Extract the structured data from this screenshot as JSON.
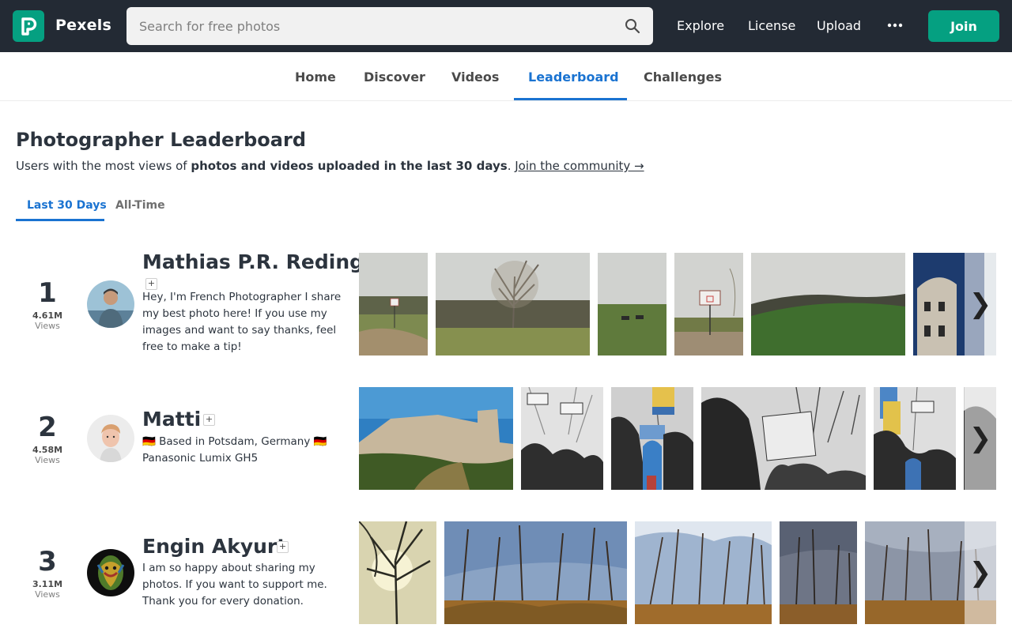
{
  "brand": {
    "name": "Pexels",
    "accent": "#05a081",
    "topbar_bg": "#232a34",
    "link_blue": "#1a73d1"
  },
  "search": {
    "placeholder": "Search for free photos",
    "value": ""
  },
  "top_nav": [
    "Explore",
    "License",
    "Upload"
  ],
  "join_label": "Join",
  "sub_nav": {
    "tabs": [
      "Home",
      "Discover",
      "Videos",
      "Leaderboard",
      "Challenges"
    ],
    "active": "Leaderboard"
  },
  "header": {
    "title": "Photographer Leaderboard",
    "subtitle_plain": "Users with the most views of ",
    "subtitle_bold": "photos and videos uploaded in the last 30 days",
    "subtitle_dot": ".",
    "join_link": "Join the community →"
  },
  "period_tabs": {
    "items": [
      "Last 30 Days",
      "All-Time"
    ],
    "active": "Last 30 Days"
  },
  "leaders": [
    {
      "rank": "1",
      "views": "4.61M",
      "views_label": "Views",
      "name": "Mathias P.R. Reding",
      "follow": "+",
      "bio": "Hey, I'm French Photographer I share my best photo here! If you use my images and want to say thanks, feel free to make a tip!"
    },
    {
      "rank": "2",
      "views": "4.58M",
      "views_label": "Views",
      "name": "Matti",
      "follow": "+",
      "bio": "🇩🇪 Based in Potsdam, Germany 🇩🇪 Panasonic Lumix GH5"
    },
    {
      "rank": "3",
      "views": "3.11M",
      "views_label": "Views",
      "name": "Engin Akyurt",
      "follow": "+",
      "bio": "I am so happy about sharing my photos. If you want to support me. Thank you for every donation."
    }
  ],
  "next_glyph": "❯"
}
